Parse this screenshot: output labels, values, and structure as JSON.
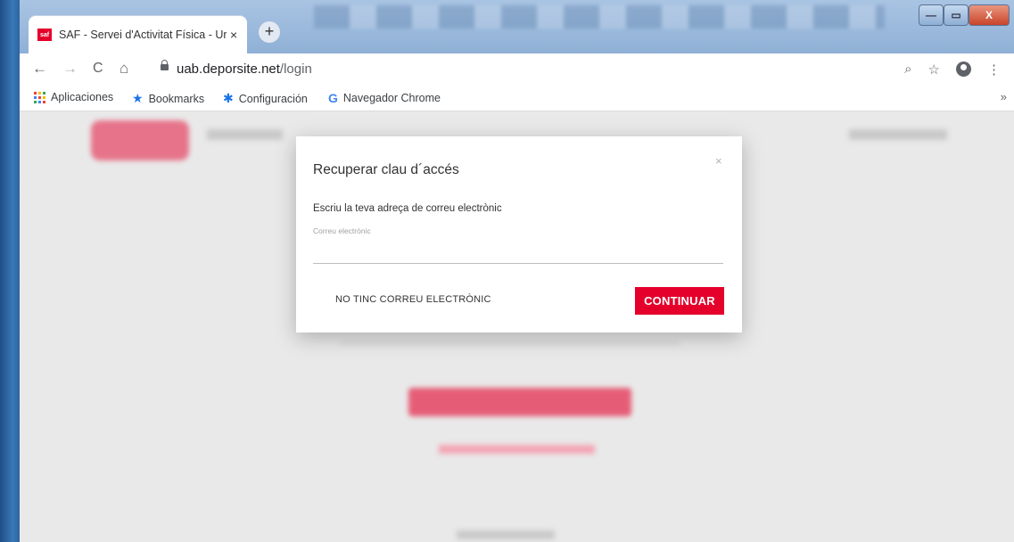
{
  "browser": {
    "tab_title": "SAF - Servei d'Activitat Física - Ur",
    "tab_close": "×",
    "new_tab": "+",
    "url_domain": "uab.deporsite.net",
    "url_path": "/login",
    "window_controls": {
      "minimize": "—",
      "maximize": "▭",
      "close": "X"
    },
    "nav": {
      "back": "←",
      "forward": "→",
      "reload": "C",
      "home": "⌂"
    },
    "omnibox_icons": {
      "zoom": "⌕",
      "bookmark": "☆",
      "menu": "⋮"
    }
  },
  "bookmarks": {
    "items": [
      {
        "label": "Aplicaciones",
        "icon": "apps-icon"
      },
      {
        "label": "Bookmarks",
        "icon": "star-icon"
      },
      {
        "label": "Configuración",
        "icon": "gear-icon"
      },
      {
        "label": "Navegador Chrome",
        "icon": "google-icon"
      }
    ],
    "overflow": "»"
  },
  "modal": {
    "title": "Recuperar clau d´accés",
    "close": "×",
    "prompt": "Escriu la teva adreça de correu electrònic",
    "email_placeholder": "Correu electrònic",
    "no_email_button": "NO TINC CORREU ELECTRÒNIC",
    "continue_button": "CONTINUAR"
  },
  "colors": {
    "accent": "#e4002b",
    "overlay": "#e9e9e9"
  }
}
